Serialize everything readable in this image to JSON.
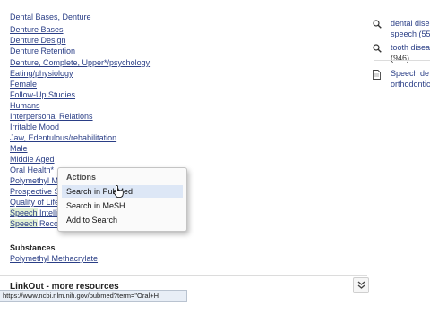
{
  "mesh_terms": [
    {
      "label": "Dental Bases, Denture"
    },
    {
      "label": "Denture Bases"
    },
    {
      "label": "Denture Design"
    },
    {
      "label": "Denture Retention"
    },
    {
      "label": "Denture, Complete, Upper*/psychology"
    },
    {
      "label": "Eating/physiology"
    },
    {
      "label": "Female"
    },
    {
      "label": "Follow-Up Studies"
    },
    {
      "label": "Humans"
    },
    {
      "label": "Interpersonal Relations"
    },
    {
      "label": "Irritable Mood"
    },
    {
      "label": "Jaw, Edentulous/rehabilitation"
    },
    {
      "label": "Male"
    },
    {
      "label": "Middle Aged"
    },
    {
      "label": "Oral Health*"
    },
    {
      "label": "Polymethyl Methacrylate"
    },
    {
      "label": "Prospective Studies"
    },
    {
      "label": "Quality of Life"
    },
    {
      "label": "Speech",
      "tail": " Intelligibility"
    },
    {
      "label": "Speech",
      "tail": " Recognition"
    }
  ],
  "substances": {
    "heading": "Substances",
    "item": "Polymethyl Methacrylate"
  },
  "linkout": {
    "heading": "LinkOut - more resources"
  },
  "status_bar": {
    "url": "https://www.ncbi.nlm.nih.gov/pubmed?term=\"Oral+H"
  },
  "context_menu": {
    "header": "Actions",
    "items": [
      "Search in PubMed",
      "Search in MeSH",
      "Add to Search"
    ]
  },
  "right_panel": {
    "items": [
      {
        "line1": "dental dise",
        "line2": "speech (55"
      },
      {
        "line1": "tooth disea",
        "line2": "(946)"
      },
      {
        "line1": "Speech de",
        "line2": "orthodontic"
      }
    ]
  },
  "icons": {
    "right_panel_search": "search-icon",
    "right_panel_doc": "document-icon",
    "expand": "chevron-double-down-icon",
    "cursor": "hand-pointer-icon"
  }
}
